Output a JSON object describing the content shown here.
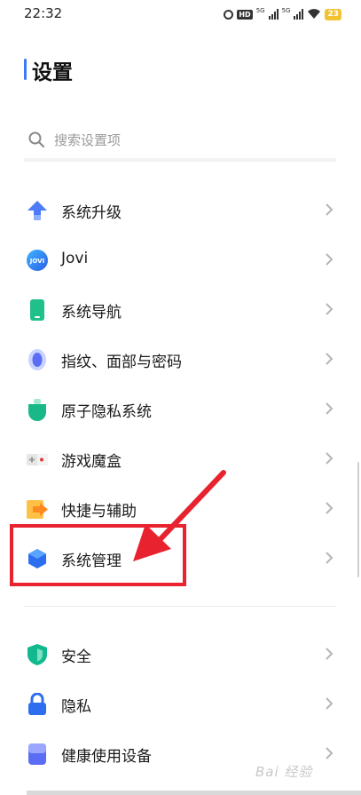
{
  "status_bar": {
    "time": "22:32",
    "hd_label": "HD",
    "net1": "5G",
    "net2": "5G",
    "battery": "23"
  },
  "page": {
    "title": "设置"
  },
  "search": {
    "placeholder": "搜索设置项"
  },
  "settings_items": [
    {
      "label": "系统升级",
      "icon": "upgrade-arrow-icon"
    },
    {
      "label": "Jovi",
      "icon": "jovi-icon",
      "icon_text": "JOVI"
    },
    {
      "label": "系统导航",
      "icon": "navigation-phone-icon"
    },
    {
      "label": "指纹、面部与密码",
      "icon": "fingerprint-icon"
    },
    {
      "label": "原子隐私系统",
      "icon": "atom-privacy-icon"
    },
    {
      "label": "游戏魔盒",
      "icon": "gamepad-icon"
    },
    {
      "label": "快捷与辅助",
      "icon": "shortcut-arrow-icon"
    },
    {
      "label": "系统管理",
      "icon": "system-management-hexagon-icon"
    },
    {
      "label": "安全",
      "icon": "security-shield-icon"
    },
    {
      "label": "隐私",
      "icon": "privacy-lock-icon"
    },
    {
      "label": "健康使用设备",
      "icon": "healthy-usage-icon"
    }
  ],
  "annotation": {
    "highlight_color": "#e8232f",
    "target": "系统管理"
  },
  "watermark": "Bai 经验",
  "colors": {
    "accent": "#3b7bf5",
    "annotation_red": "#e8232f"
  }
}
